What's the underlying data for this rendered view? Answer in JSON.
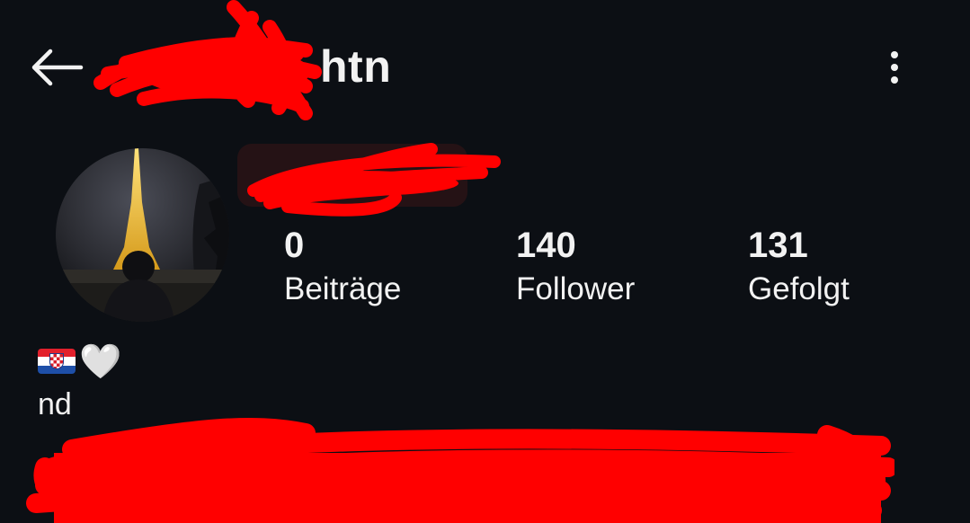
{
  "header": {
    "back_icon": "arrow-left-icon",
    "username_visible_suffix": "htn",
    "more_icon": "vertical-ellipsis-icon"
  },
  "profile": {
    "avatar_description_icon": "avatar-image",
    "stats": [
      {
        "value": "0",
        "label": "Beiträge"
      },
      {
        "value": "140",
        "label": "Follower"
      },
      {
        "value": "131",
        "label": "Gefolgt"
      }
    ]
  },
  "bio": {
    "emoji_flag": "croatia-flag-icon",
    "emoji_heart": "🤍",
    "text": "nd"
  },
  "colors": {
    "background": "#0c0f14",
    "text": "#f2f2f2",
    "redaction": "#ff0000"
  }
}
